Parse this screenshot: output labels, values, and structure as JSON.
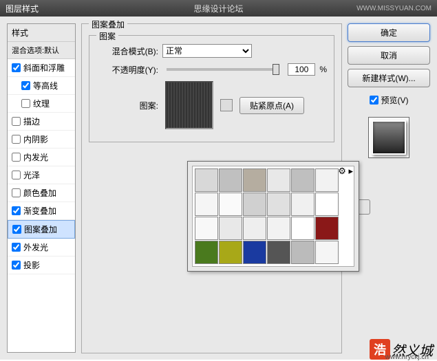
{
  "titlebar": {
    "title": "图层样式",
    "center": "思缘设计论坛",
    "url": "WWW.MISSYUAN.COM"
  },
  "sidebar": {
    "header": "样式",
    "sub": "混合选项:默认",
    "items": [
      {
        "label": "斜面和浮雕",
        "checked": true,
        "indent": false
      },
      {
        "label": "等高线",
        "checked": true,
        "indent": true
      },
      {
        "label": "纹理",
        "checked": false,
        "indent": true
      },
      {
        "label": "描边",
        "checked": false,
        "indent": false
      },
      {
        "label": "内阴影",
        "checked": false,
        "indent": false
      },
      {
        "label": "内发光",
        "checked": false,
        "indent": false
      },
      {
        "label": "光泽",
        "checked": false,
        "indent": false
      },
      {
        "label": "颜色叠加",
        "checked": false,
        "indent": false
      },
      {
        "label": "渐变叠加",
        "checked": true,
        "indent": false
      },
      {
        "label": "图案叠加",
        "checked": true,
        "indent": false,
        "active": true
      },
      {
        "label": "外发光",
        "checked": true,
        "indent": false
      },
      {
        "label": "投影",
        "checked": true,
        "indent": false
      }
    ]
  },
  "main": {
    "group_title": "图案叠加",
    "inner_title": "图案",
    "blend_label": "混合模式(B):",
    "blend_value": "正常",
    "opacity_label": "不透明度(Y):",
    "opacity_value": "100",
    "opacity_unit": "%",
    "pattern_label": "图案:",
    "snap_label": "贴紧原点(A)"
  },
  "popup": {
    "swatches": [
      "#d8d8d8",
      "#c0c0c0",
      "#b5ada0",
      "#e8e8e8",
      "#bfbfbf",
      "#f2f2f2",
      "#f5f5f5",
      "#fafafa",
      "#d0d0d0",
      "#e0e0e0",
      "#f0f0f0",
      "#ffffff",
      "#f8f8f8",
      "#e8e8e8",
      "#eeeeee",
      "#f2f2f2",
      "#ffffff",
      "#8a1818",
      "#4a7a1e",
      "#a8a818",
      "#1a3aa0",
      "#555555",
      "#bbbbbb",
      "#f5f5f5"
    ]
  },
  "rpanel": {
    "ok": "确定",
    "cancel": "取消",
    "new_style": "新建样式(W)...",
    "preview": "预览(V)"
  },
  "watermark": {
    "badge": "浩",
    "text": "然义城",
    "url": "www.hryckj.cn"
  }
}
